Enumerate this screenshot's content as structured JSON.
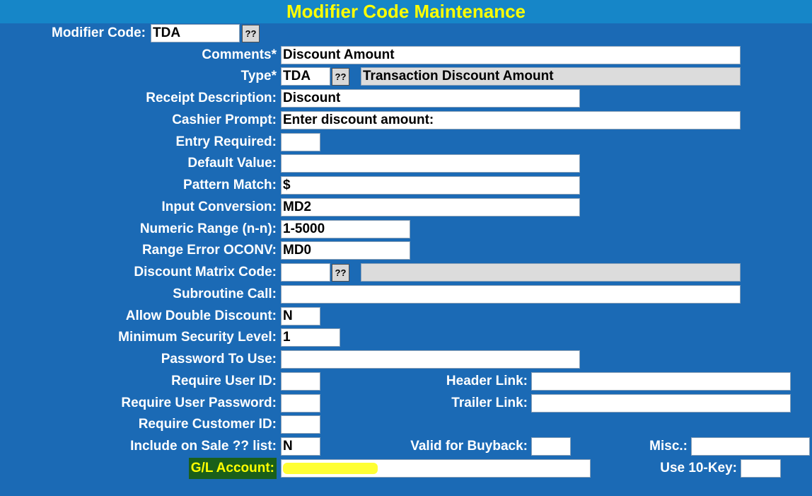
{
  "title": "Modifier Code Maintenance",
  "fields": {
    "modifier_code": {
      "label": "Modifier Code:",
      "value": "TDA",
      "lookup": "??"
    },
    "comments": {
      "label": "Comments*",
      "value": "Discount Amount"
    },
    "type": {
      "label": "Type*",
      "value": "TDA",
      "lookup": "??",
      "description": "Transaction Discount Amount"
    },
    "receipt_description": {
      "label": "Receipt Description:",
      "value": "Discount"
    },
    "cashier_prompt": {
      "label": "Cashier Prompt:",
      "value": "Enter discount amount:"
    },
    "entry_required": {
      "label": "Entry Required:",
      "value": ""
    },
    "default_value": {
      "label": "Default Value:",
      "value": ""
    },
    "pattern_match": {
      "label": "Pattern Match:",
      "value": "$"
    },
    "input_conversion": {
      "label": "Input Conversion:",
      "value": "MD2"
    },
    "numeric_range": {
      "label": "Numeric Range (n-n):",
      "value": "1-5000"
    },
    "range_error_oconv": {
      "label": "Range Error OCONV:",
      "value": "MD0"
    },
    "discount_matrix_code": {
      "label": "Discount Matrix Code:",
      "value": "",
      "lookup": "??",
      "description": ""
    },
    "subroutine_call": {
      "label": "Subroutine Call:",
      "value": ""
    },
    "allow_double_discount": {
      "label": "Allow Double Discount:",
      "value": "N"
    },
    "minimum_security_level": {
      "label": "Minimum Security Level:",
      "value": "1"
    },
    "password_to_use": {
      "label": "Password To Use:",
      "value": ""
    },
    "require_user_id": {
      "label": "Require User ID:",
      "value": ""
    },
    "header_link": {
      "label": "Header Link:",
      "value": ""
    },
    "require_user_password": {
      "label": "Require User Password:",
      "value": ""
    },
    "trailer_link": {
      "label": "Trailer Link:",
      "value": ""
    },
    "require_customer_id": {
      "label": "Require Customer ID:",
      "value": ""
    },
    "include_on_sale_list": {
      "label": "Include on Sale ?? list:",
      "value": "N"
    },
    "valid_for_buyback": {
      "label": "Valid for Buyback:",
      "value": ""
    },
    "misc": {
      "label": "Misc.:",
      "value": ""
    },
    "gl_account": {
      "label": "G/L Account:",
      "value": ""
    },
    "use_10_key": {
      "label": "Use 10-Key:",
      "value": ""
    }
  },
  "colors": {
    "background": "#1b6ab5",
    "title_bar": "#1686c8",
    "title_text": "#ffff00",
    "gl_label_bg": "#1a5f1a",
    "gl_highlight": "#ffff33"
  }
}
